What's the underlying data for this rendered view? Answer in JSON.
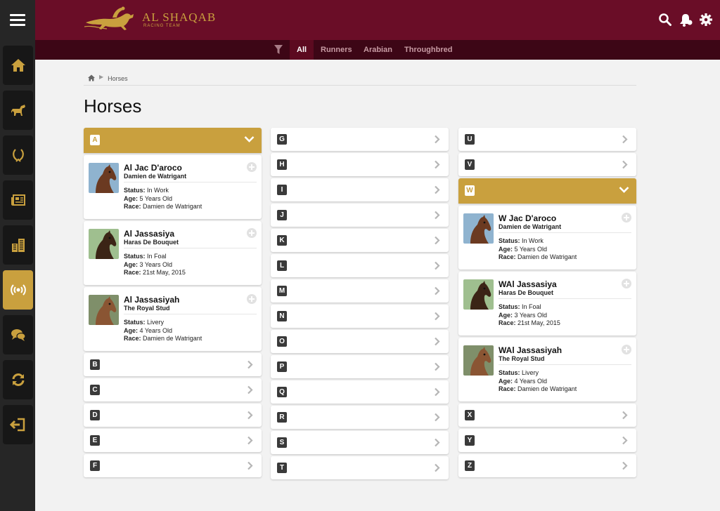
{
  "brand": {
    "name": "AL SHAQAB",
    "tagline": "RACING TEAM"
  },
  "subnav": {
    "tabs": [
      "All",
      "Runners",
      "Arabian",
      "Throughbred"
    ],
    "active": "All"
  },
  "breadcrumb": {
    "current": "Horses"
  },
  "page": {
    "title": "Horses"
  },
  "labels": {
    "status": "Status:",
    "age": "Age:",
    "race": "Race:"
  },
  "columns": [
    {
      "open": {
        "letter": "A",
        "cards": [
          {
            "name": "Al Jac D'aroco",
            "owner": "Damien de Watrigant",
            "status": "In Work",
            "age": "5 Years Old",
            "race": "Damien de Watrigant"
          },
          {
            "name": "Al Jassasiya",
            "owner": "Haras De Bouquet",
            "status": "In Foal",
            "age": "3 Years Old",
            "race": "21st May, 2015"
          },
          {
            "name": "Al Jassasiyah",
            "owner": "The Royal Stud",
            "status": "Livery",
            "age": "4 Years Old",
            "race": "Damien de Watrigant"
          }
        ]
      },
      "after": [
        "B",
        "C",
        "D",
        "E",
        "F"
      ]
    },
    {
      "letters": [
        "G",
        "H",
        "I",
        "J",
        "K",
        "L",
        "M",
        "N",
        "O",
        "P",
        "Q",
        "R",
        "S",
        "T"
      ]
    },
    {
      "before": [
        "U",
        "V"
      ],
      "open": {
        "letter": "W",
        "cards": [
          {
            "name": "W Jac D'aroco",
            "owner": "Damien de Watrigant",
            "status": "In Work",
            "age": "5 Years Old",
            "race": "Damien de Watrigant"
          },
          {
            "name": "WAl Jassasiya",
            "owner": "Haras De Bouquet",
            "status": "In Foal",
            "age": "3 Years Old",
            "race": "21st May, 2015"
          },
          {
            "name": "WAl Jassasiyah",
            "owner": "The Royal Stud",
            "status": "Livery",
            "age": "4 Years Old",
            "race": "Damien de Watrigant"
          }
        ]
      },
      "after": [
        "X",
        "Y",
        "Z"
      ]
    }
  ],
  "icons": {
    "sidebar": [
      "home-icon",
      "horse-icon",
      "laurel-wreath-icon",
      "newspaper-icon",
      "buildings-icon",
      "broadcast-icon",
      "chat-bubbles-icon",
      "refresh-icon",
      "logout-icon"
    ],
    "header": [
      "search-icon",
      "bell-icon",
      "gear-icon"
    ]
  },
  "colors": {
    "brand": "#6a0d27",
    "subnav": "#3d0616",
    "gold": "#c9a03e",
    "sidebar": "#262626"
  }
}
